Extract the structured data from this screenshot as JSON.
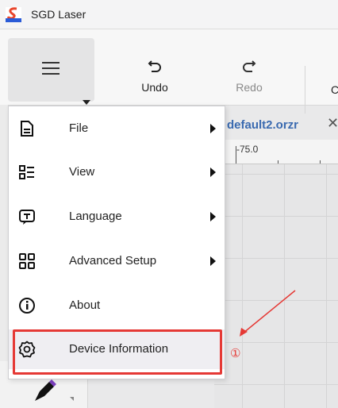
{
  "window": {
    "title": "SGD Laser",
    "logo_caption": "SGD Laser"
  },
  "toolbar": {
    "undo_label": "Undo",
    "redo_label": "Redo",
    "partial_label": "C"
  },
  "tab": {
    "title": "default2.orzr",
    "close_glyph": "✕"
  },
  "ruler": {
    "label": "-75.0"
  },
  "menu": {
    "items": [
      {
        "label": "File",
        "icon": "file-icon",
        "has_submenu": true
      },
      {
        "label": "View",
        "icon": "view-list-icon",
        "has_submenu": true
      },
      {
        "label": "Language",
        "icon": "language-icon",
        "has_submenu": true
      },
      {
        "label": "Advanced Setup",
        "icon": "grid-icon",
        "has_submenu": true
      },
      {
        "label": "About",
        "icon": "info-icon",
        "has_submenu": false
      },
      {
        "label": "Device Information",
        "icon": "gear-icon",
        "has_submenu": false
      }
    ]
  },
  "annotation": {
    "label": "①",
    "color": "#e53935"
  },
  "colors": {
    "accent_tab": "#3a6ab0",
    "annotation_red": "#e53935"
  }
}
